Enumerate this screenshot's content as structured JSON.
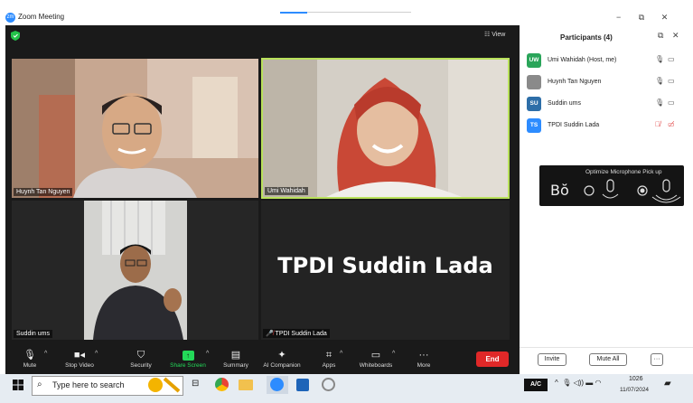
{
  "window": {
    "app_icon": "zm",
    "title": "Zoom Meeting",
    "controls": [
      "−",
      "⧉",
      "✕"
    ]
  },
  "stage": {
    "view_label": "View"
  },
  "tiles": [
    {
      "name": "Huynh Tan Nguyen"
    },
    {
      "name": "Umi Wahidah",
      "active_speaker": true
    },
    {
      "name": "Suddin ums"
    },
    {
      "name": "TPDI Suddin Lada",
      "big_text": "TPDI Suddin Lada",
      "muted": true
    }
  ],
  "toolbar": {
    "mute": "Mute",
    "stop_video": "Stop Video",
    "security": "Security",
    "share_screen": "Share Screen",
    "summary": "Summary",
    "ai_companion": "AI Companion",
    "apps": "Apps",
    "whiteboards": "Whiteboards",
    "more": "More",
    "end": "End"
  },
  "participants": {
    "title": "Participants (4)",
    "list": [
      {
        "initials": "UW",
        "name": "Umi Wahidah (Host, me)",
        "color": "#2aa55a"
      },
      {
        "initials": "",
        "name": "Huynh Tan Nguyen",
        "color": "#8a8a8a"
      },
      {
        "initials": "SU",
        "name": "Suddin ums",
        "color": "#2d6ea8"
      },
      {
        "initials": "TS",
        "name": "TPDI Suddin Lada",
        "color": "#2d8cff"
      }
    ],
    "mic_card_title": "Optimize Microphone Pick up",
    "invite": "Invite",
    "mute_all": "Mute All",
    "more": "···"
  },
  "taskbar": {
    "search_placeholder": "Type here to search",
    "ac_label": "A/C",
    "time": "1026",
    "date": "11/07/2024"
  },
  "colors": {
    "accent": "#2d8cff",
    "active_speaker": "#b9e15b",
    "end": "#e02828",
    "share": "#23d959"
  }
}
